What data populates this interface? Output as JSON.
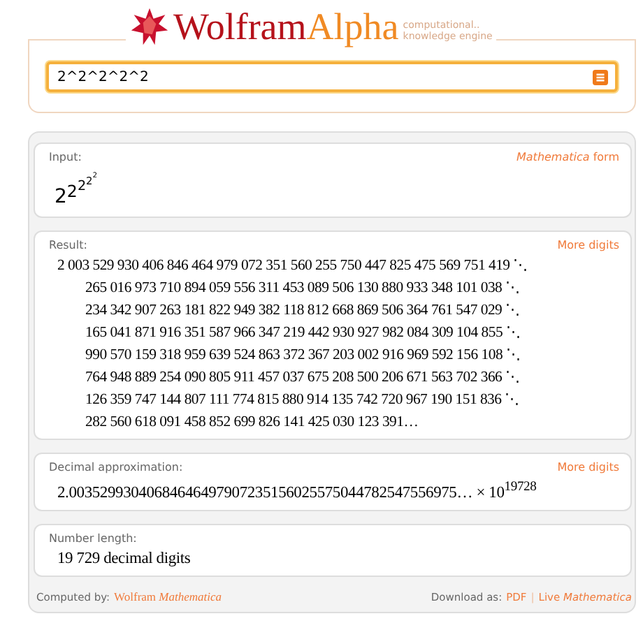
{
  "logo": {
    "word_1": "Wolfram",
    "word_2": "Alpha",
    "tagline": [
      "computational..",
      "knowledge engine"
    ]
  },
  "search": {
    "value": "2^2^2^2^2"
  },
  "pods": [
    {
      "kind": "tower",
      "title": "Input:",
      "link": "*Mathematica* form",
      "tower": [
        "2",
        "2",
        "2",
        "2",
        "2"
      ]
    },
    {
      "kind": "lines",
      "title": "Result:",
      "link": "More digits",
      "lines": [
        "2 003 529 930 406 846 464 979 072 351 560 255 750 447 825 475 569 751 419 ⋱",
        "265 016 973 710 894 059 556 311 453 089 506 130 880 933 348 101 038 ⋱",
        "234 342 907 263 181 822 949 382 118 812 668 869 506 364 761 547 029 ⋱",
        "165 041 871 916 351 587 966 347 219 442 930 927 982 084 309 104 855 ⋱",
        "990 570 159 318 959 639 524 863 372 367 203 002 916 969 592 156 108 ⋱",
        "764 948 889 254 090 805 911 457 037 675 208 500 206 671 563 702 366 ⋱",
        "126 359 747 144 807 111 774 815 880 914 135 742 720 967 190 151 836 ⋱",
        "282 560 618 091 458 852 699 826 141 425 030 123 391…"
      ]
    },
    {
      "kind": "text",
      "title": "Decimal approximation:",
      "link": "More digits",
      "text": "2.00352993040684646497907235156025575044782547556975… × 10$^{19728}$"
    },
    {
      "kind": "text",
      "title": "Number length:",
      "text": "19 729 decimal digits"
    }
  ],
  "footer": {
    "computed_label": "Computed by:",
    "computed_link": "Wolfram *Mathematica*",
    "download_label": "Download as:",
    "download_links": [
      "PDF",
      "Live *Mathematica*"
    ],
    "separator": "|"
  }
}
